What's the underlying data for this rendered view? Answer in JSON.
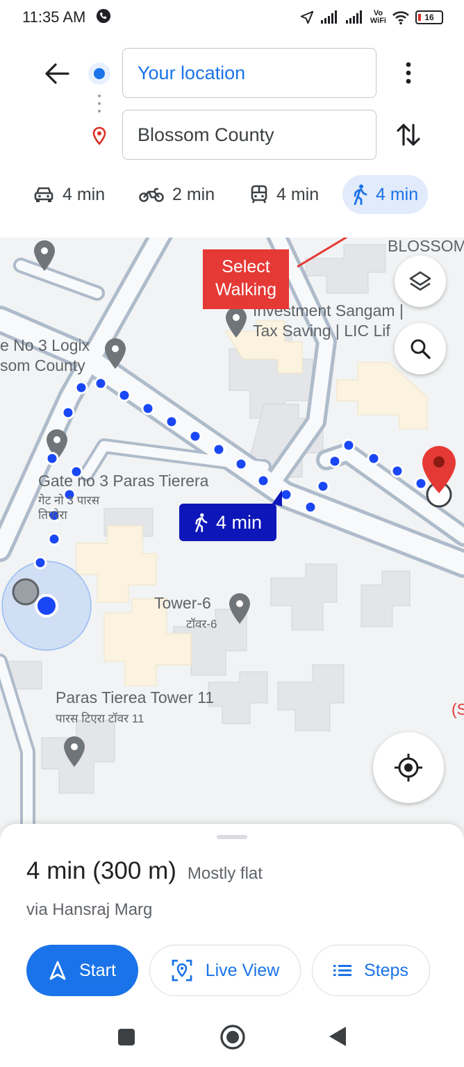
{
  "status_bar": {
    "time": "11:35 AM",
    "vowifi_top": "Vo",
    "vowifi_bottom": "WiFi",
    "battery": "16",
    "icons": [
      "call-icon",
      "location-arrow-icon",
      "signal-icon",
      "signal-icon",
      "wifi-icon",
      "battery-icon"
    ]
  },
  "header": {
    "origin": "Your location",
    "destination": "Blossom County",
    "modes": [
      {
        "icon": "car-icon",
        "label": "4 min"
      },
      {
        "icon": "motorcycle-icon",
        "label": "2 min"
      },
      {
        "icon": "transit-icon",
        "label": "4 min"
      },
      {
        "icon": "walk-icon",
        "label": "4 min",
        "selected": true
      }
    ]
  },
  "map": {
    "annotation": {
      "line1": "Select",
      "line2": "Walking"
    },
    "labels": {
      "blossom": "BLOSSOM",
      "investment_1": "Investment Sangam |",
      "investment_2": "Tax Saving | LIC Lif",
      "logix_1": "e No 3 Logix",
      "logix_2": "som County",
      "gate_en": "Gate no 3 Paras Tierera",
      "gate_hi_1": "गेट नो 3 पारस",
      "gate_hi_2": "तिएरेरा",
      "tower6_en": "Tower-6",
      "tower6_hi": "टॉवर-6",
      "tower11_en": "Paras Tierea Tower 11",
      "tower11_hi": "पारस टिएरा टॉवर 11",
      "edge_s": "(S"
    },
    "route_chip": "4 min",
    "colors": {
      "route": "#1a47f5",
      "chip": "#0d16b8",
      "annotation": "#e53935",
      "pin": "#d93025"
    }
  },
  "sheet": {
    "duration": "4 min (300 m)",
    "terrain": "Mostly flat",
    "via": "via Hansraj Marg",
    "start_label": "Start",
    "live_view_label": "Live View",
    "steps_label": "Steps"
  }
}
